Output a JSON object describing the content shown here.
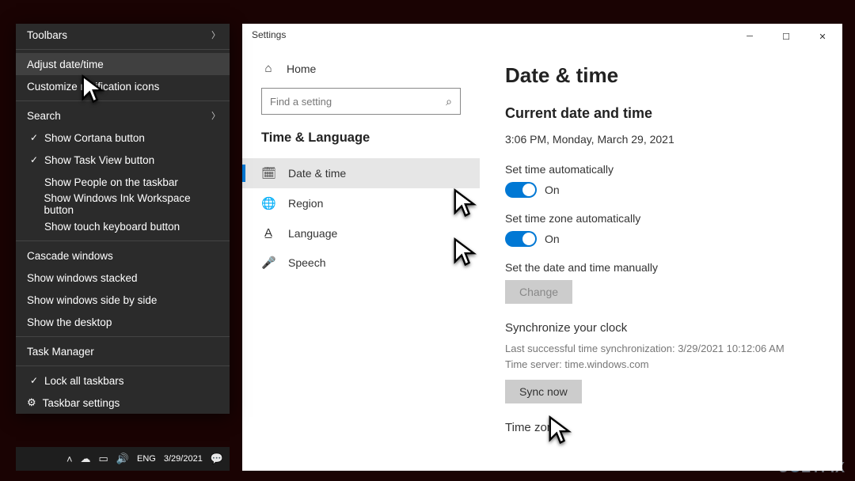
{
  "context_menu": {
    "toolbars": "Toolbars",
    "adjust": "Adjust date/time",
    "customize": "Customize notification icons",
    "search": "Search",
    "cortana": "Show Cortana button",
    "taskview": "Show Task View button",
    "people": "Show People on the taskbar",
    "ink": "Show Windows Ink Workspace button",
    "touch": "Show touch keyboard button",
    "cascade": "Cascade windows",
    "stacked": "Show windows stacked",
    "sidebyside": "Show windows side by side",
    "desktop": "Show the desktop",
    "taskmgr": "Task Manager",
    "lock": "Lock all taskbars",
    "tbsettings": "Taskbar settings"
  },
  "taskbar": {
    "lang": "ENG",
    "date": "3/29/2021"
  },
  "settings": {
    "title": "Settings",
    "home": "Home",
    "search_placeholder": "Find a setting",
    "category": "Time & Language",
    "nav": {
      "datetime": "Date & time",
      "region": "Region",
      "language": "Language",
      "speech": "Speech"
    },
    "page": {
      "heading": "Date & time",
      "subheading": "Current date and time",
      "now": "3:06 PM, Monday, March 29, 2021",
      "set_time_auto": "Set time automatically",
      "on1": "On",
      "set_tz_auto": "Set time zone automatically",
      "on2": "On",
      "set_manual": "Set the date and time manually",
      "change": "Change",
      "sync_h": "Synchronize your clock",
      "sync_info1": "Last successful time synchronization: 3/29/2021 10:12:06 AM",
      "sync_info2": "Time server: time.windows.com",
      "sync_btn": "Sync now",
      "tz_h": "Time zone"
    }
  },
  "watermark": "UGETFIX"
}
